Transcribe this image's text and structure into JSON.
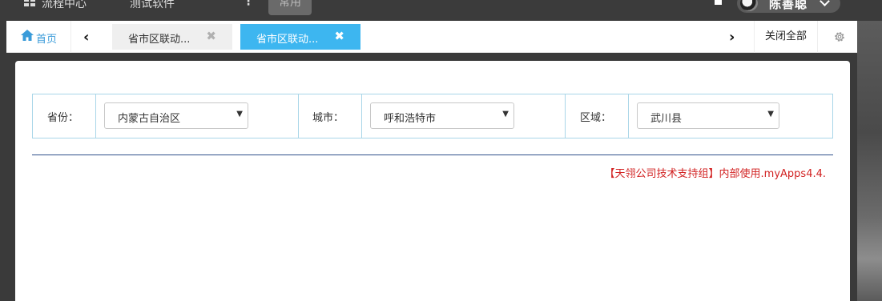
{
  "topnav": {
    "flow_center": "流程中心",
    "test_software": "测试软件",
    "more": "⋮",
    "common": "常用"
  },
  "user": {
    "name": "陈善聪"
  },
  "tabs": {
    "home_label": "首页",
    "prev": "‹",
    "next": "›",
    "items": [
      {
        "label": "省市区联动...",
        "close": "✖",
        "active": false
      },
      {
        "label": "省市区联动...",
        "close": "✖",
        "active": true
      }
    ],
    "close_all": "关闭全部"
  },
  "filters": {
    "province_label": "省份：",
    "province_value": "内蒙古自治区",
    "city_label": "城市：",
    "city_value": "呼和浩特市",
    "district_label": "区域：",
    "district_value": "武川县",
    "arrow": "▼"
  },
  "footer": {
    "note": "【天翎公司技术支持组】内部使用.myApps4.4."
  },
  "colors": {
    "accent": "#3db6f0",
    "home": "#3a9bd9",
    "note": "#d22222",
    "divider": "#2d4f8a"
  }
}
